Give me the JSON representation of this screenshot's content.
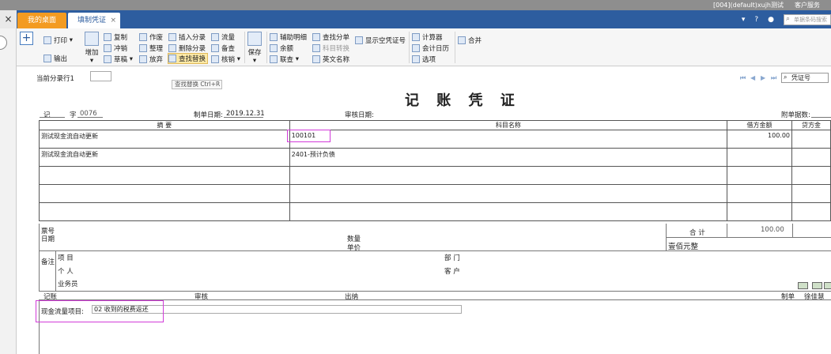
{
  "topbar": {
    "account": "[004](default)xujh测试",
    "service": "客户服务"
  },
  "tabs": {
    "desktop": "我的桌面",
    "voucher": "填制凭证",
    "close": "×",
    "close_all": "×"
  },
  "header_search": {
    "placeholder": "单据条码搜索"
  },
  "toolbar": {
    "add_label": "+",
    "print": "打印",
    "export": "输出",
    "add": "增加",
    "copy": "复制",
    "reverse": "冲销",
    "draft": "草稿",
    "void": "作废",
    "tidy": "整理",
    "discard": "放弃",
    "insert_entry": "插入分录",
    "delete_entry": "删除分录",
    "find_replace": "查找替换",
    "cashflow": "流量",
    "memo": "备查",
    "verify": "核销",
    "save": "保存",
    "aux_detail": "辅助明细",
    "balance": "余额",
    "inquiry": "联查",
    "find_entry": "查找分单",
    "subject_convert": "科目转换",
    "english_name": "英文名称",
    "show_empty": "显示空凭证号",
    "calculator": "计算器",
    "accounting_calendar": "会计日历",
    "options": "选项",
    "merge": "合并",
    "tooltip": "查找替换 Ctrl+R"
  },
  "voucher": {
    "current_row_label": "当前分录行1",
    "title": "记 账 凭 证",
    "nav_search": "凭证号",
    "type": "记",
    "number_label": "字",
    "number": "0076",
    "date_label": "制单日期:",
    "date": "2019.12.31",
    "audit_date_label": "审核日期:",
    "attach_label": "附单据数:",
    "headers": {
      "summary": "摘 要",
      "subject": "科目名称",
      "debit": "借方金额",
      "credit": "贷方金"
    },
    "rows": [
      {
        "summary": "测试现金流自动更新",
        "subject": "100101",
        "debit": "100.00",
        "credit": ""
      },
      {
        "summary": "测试现金流自动更新",
        "subject": "2401-预计负债",
        "debit": "",
        "credit": ""
      }
    ],
    "ticket_no": "票号",
    "ticket_date": "日期",
    "quantity": "数量",
    "unit_price": "单价",
    "total_label": "合 计",
    "total_amount": "100.00",
    "total_words": "壹佰元整",
    "remarks": "备注",
    "project": "项 目",
    "department": "部 门",
    "person": "个 人",
    "customer": "客 户",
    "salesman": "业务员",
    "bookkeeping": "记账",
    "auditor": "审核",
    "cashier": "出纳",
    "maker_label": "制单",
    "maker": "徐佳慧",
    "cashflow_label": "现金流量项目:",
    "cashflow_value": "02 收到的税费返还"
  }
}
